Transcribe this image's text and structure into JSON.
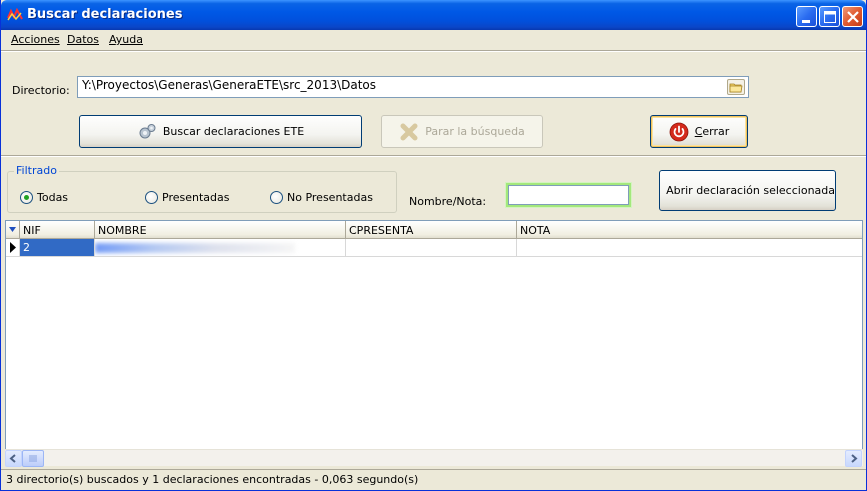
{
  "window": {
    "title": "Buscar declaraciones"
  },
  "menu": {
    "items": [
      {
        "accel": "A",
        "rest": "cciones"
      },
      {
        "accel": "D",
        "rest": "atos"
      },
      {
        "accel": "A",
        "rest": "yuda"
      }
    ]
  },
  "directory": {
    "label": "Directorio:",
    "value": "Y:\\Proyectos\\Generas\\GeneraETE\\src_2013\\Datos",
    "browse_icon": "folder-icon"
  },
  "actions": {
    "search_label": "Buscar declaraciones ETE",
    "stop_label": "Parar la búsqueda",
    "close_accel": "C",
    "close_rest": "errar"
  },
  "filter": {
    "legend": "Filtrado",
    "options": [
      "Todas",
      "Presentadas",
      "No Presentadas"
    ],
    "selected": "Todas",
    "nota_label": "Nombre/Nota:",
    "nota_value": ""
  },
  "open_button": {
    "label": "Abrir declaración seleccionada"
  },
  "grid": {
    "columns": [
      "NIF",
      "NOMBRE",
      "CPRESENTA",
      "NOTA"
    ],
    "rows": [
      {
        "nif": "2",
        "nombre": "",
        "cpresenta": "",
        "nota": ""
      }
    ]
  },
  "status": {
    "text": "3 directorio(s) buscados y 1 declaraciones encontradas - 0,063 segundo(s)"
  },
  "colors": {
    "accent": "#0058e6",
    "group_legend": "#0046d5",
    "close_red": "#d42a1c"
  }
}
